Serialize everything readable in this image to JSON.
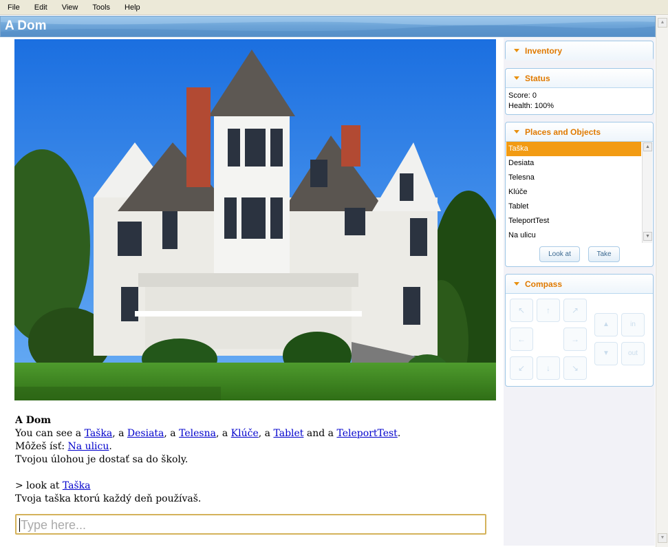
{
  "menu": [
    "File",
    "Edit",
    "View",
    "Tools",
    "Help"
  ],
  "window_title": "A Dom",
  "scene_image": "victorian-house-photo",
  "output": {
    "heading": "A Dom",
    "see_prefix": "You can see a ",
    "objects": [
      "Taška",
      "Desiata",
      "Telesna",
      "Klúče",
      "Tablet",
      "TeleportTest"
    ],
    "sep_a": ", a ",
    "and_a": " and a ",
    "end_period": ".",
    "exits_prefix": "Môžeš ísť: ",
    "exit_link": "Na ulicu",
    "goal": "Tvojou úlohou je dostať sa do školy.",
    "cmd_prefix": "> look at ",
    "cmd_link": "Taška",
    "response": "Tvoja taška ktorú každý deň používaš."
  },
  "input": {
    "placeholder": "Type here..."
  },
  "panels": {
    "inventory": {
      "title": "Inventory"
    },
    "status": {
      "title": "Status",
      "score_line": "Score: 0",
      "health_line": "Health: 100%"
    },
    "places": {
      "title": "Places and Objects",
      "items": [
        "Taška",
        "Desiata",
        "Telesna",
        "Klúče",
        "Tablet",
        "TeleportTest",
        "Na ulicu"
      ],
      "selected": "Taška",
      "look_button": "Look at",
      "take_button": "Take"
    },
    "compass": {
      "title": "Compass",
      "arrows": {
        "nw": "↖",
        "n": "↑",
        "ne": "↗",
        "w": "←",
        "e": "→",
        "sw": "↙",
        "s": "↓",
        "se": "↘",
        "up": "▲",
        "down": "▼"
      },
      "in_label": "in",
      "out_label": "out"
    }
  },
  "colors": {
    "accent": "#f29b13",
    "panel_title": "#e07a00",
    "link": "#0000cc",
    "titlebar": "#6ea5d8"
  }
}
